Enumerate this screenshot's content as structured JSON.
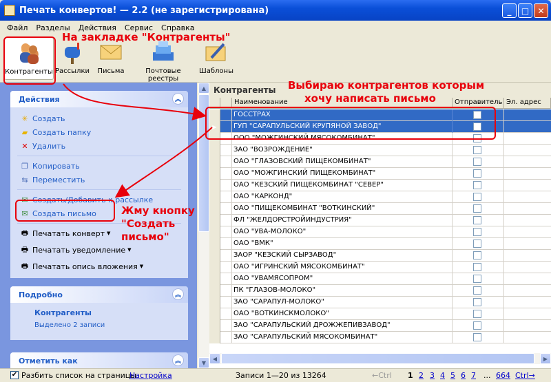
{
  "window": {
    "title": "Печать конвертов! — 2.2 (не зарегистрирована)"
  },
  "menu": [
    "Файл",
    "Разделы",
    "Действия",
    "Сервис",
    "Справка"
  ],
  "toolbar": [
    {
      "label": "Контрагенты",
      "icon": "contacts-icon"
    },
    {
      "label": "Рассылки",
      "icon": "mailbox-icon"
    },
    {
      "label": "Письма",
      "icon": "envelope-icon"
    },
    {
      "label": "Почтовые реестры",
      "icon": "registry-icon"
    },
    {
      "label": "Шаблоны",
      "icon": "template-icon"
    }
  ],
  "actions": {
    "title": "Действия",
    "items": [
      {
        "label": "Создать"
      },
      {
        "label": "Создать папку"
      },
      {
        "label": "Удалить"
      },
      {
        "label": "Копировать"
      },
      {
        "label": "Переместить"
      },
      {
        "label": "Создать/Добавить к рассылке"
      },
      {
        "label": "Создать письмо"
      },
      {
        "label": "Печатать конверт"
      },
      {
        "label": "Печатать уведомление"
      },
      {
        "label": "Печатать опись вложения"
      }
    ]
  },
  "details": {
    "title": "Подробно",
    "heading": "Контрагенты",
    "text": "Выделено 2 записи"
  },
  "mark": {
    "title": "Отметить как"
  },
  "grid": {
    "title": "Контрагенты",
    "columns": [
      "Наименование",
      "Отправитель",
      "Эл. адрес"
    ],
    "rows": [
      "ГОССТРАХ",
      "ГУП \"САРАПУЛЬСКИЙ КРУПЯНОЙ ЗАВОД\"",
      "ООО \"МОЖГИНСКИЙ МЯСОКОМБИНАТ\"",
      "ЗАО \"ВОЗРОЖДЕНИЕ\"",
      "ОАО \"ГЛАЗОВСКИЙ ПИЩЕКОМБИНАТ\"",
      "ОАО \"МОЖГИНСКИЙ ПИЩЕКОМБИНАТ\"",
      "ОАО \"КЕЗСКИЙ ПИЩЕКОМБИНАТ \"СЕВЕР\"",
      "ОАО \"КАРКОНД\"",
      "ОАО \"ПИЩЕКОМБИНАТ \"ВОТКИНСКИЙ\"",
      "ФЛ \"ЖЕЛДОРСТРОЙИНДУСТРИЯ\"",
      "ОАО \"УВА-МОЛОКО\"",
      "ОАО \"ВМК\"",
      "ЗАОР \"КЕЗСКИЙ СЫРЗАВОД\"",
      "ОАО \"ИГРИНСКИЙ МЯСОКОМБИНАТ\"",
      "ОАО \"УВАМЯСОПРОМ\"",
      "ПК \"ГЛАЗОВ-МОЛОКО\"",
      "ЗАО \"САРАПУЛ-МОЛОКО\"",
      "ОАО \"ВОТКИНСКМОЛОКО\"",
      "ЗАО \"САРАПУЛЬСКИЙ ДРОЖЖЕПИВЗАВОД\"",
      "ЗАО \"САРАПУЛЬСКИЙ МЯСОКОМБИНАТ\""
    ]
  },
  "status": {
    "split_label": "Разбить список на страницы",
    "settings_link": "Настройка",
    "records": "Записи 1—20 из 13264",
    "prev": "←Ctrl",
    "pages": [
      "1",
      "2",
      "3",
      "4",
      "5",
      "6",
      "7",
      "...",
      "664"
    ],
    "next": "Ctrl→"
  },
  "annotations": {
    "tab_note": "На закладке \"Контрагенты\"",
    "select_note_1": "Выбираю контрагентов которым",
    "select_note_2": "хочу написать письмо",
    "button_note_1": "Жму кнопку",
    "button_note_2": "\"Создать",
    "button_note_3": "письмо\""
  }
}
